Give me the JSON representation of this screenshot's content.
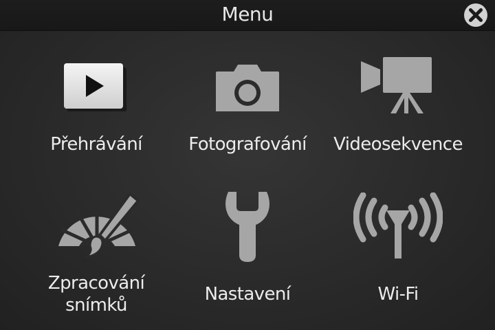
{
  "header": {
    "title": "Menu",
    "close_icon": "close-circle-icon"
  },
  "menu": {
    "items": [
      {
        "label": "Přehrávání",
        "icon": "playback-icon"
      },
      {
        "label": "Fotografování",
        "icon": "camera-icon"
      },
      {
        "label": "Videosekvence",
        "icon": "movie-camera-icon"
      },
      {
        "label": "Zpracování\nsnímků",
        "icon": "retouch-icon"
      },
      {
        "label": "Nastavení",
        "icon": "wrench-icon"
      },
      {
        "label": "Wi-Fi",
        "icon": "wifi-antenna-icon"
      }
    ]
  },
  "colors": {
    "background": "#2b2b2b",
    "titlebar": "#1b1b1b",
    "icon_gray": "#a8a8a8",
    "text": "#ececec"
  }
}
